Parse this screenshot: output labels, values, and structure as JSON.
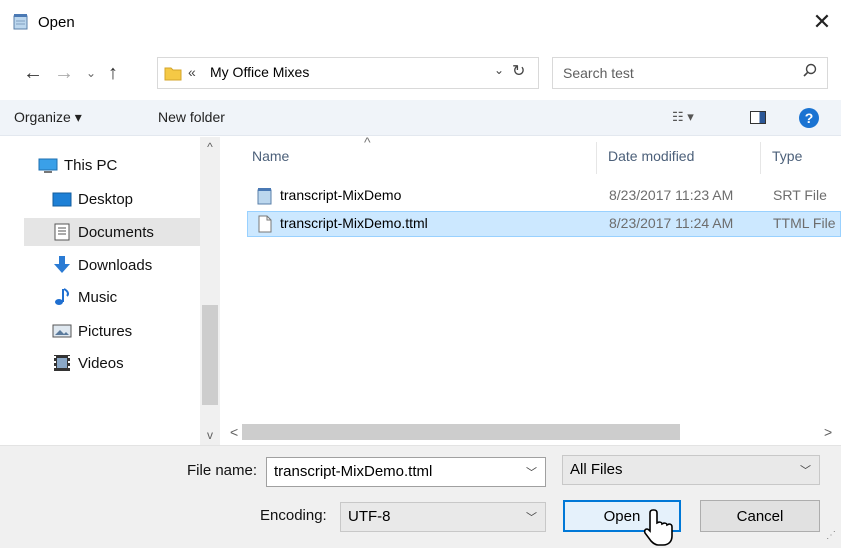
{
  "window": {
    "title": "Open",
    "close_label": "✕"
  },
  "nav": {
    "back": "←",
    "forward": "→",
    "recent": "⌄",
    "up": "↑",
    "breadcrumb_chevron": "«",
    "address": "My Office Mixes",
    "address_dropdown": "⌄",
    "refresh": "↻",
    "search_placeholder": "Search test",
    "search_icon": "⚲"
  },
  "toolbar": {
    "organize": "Organize ▾",
    "new_folder": "New folder",
    "views": "☷ ▾",
    "help": "?"
  },
  "sidebar": {
    "items": [
      {
        "label": "This PC",
        "icon": "pc-icon"
      },
      {
        "label": "Desktop",
        "icon": "desktop-icon"
      },
      {
        "label": "Documents",
        "icon": "documents-icon",
        "selected": true
      },
      {
        "label": "Downloads",
        "icon": "downloads-icon"
      },
      {
        "label": "Music",
        "icon": "music-icon"
      },
      {
        "label": "Pictures",
        "icon": "pictures-icon"
      },
      {
        "label": "Videos",
        "icon": "videos-icon"
      }
    ],
    "scroll_up": "^",
    "scroll_down": "v"
  },
  "filelist": {
    "columns": {
      "name": "Name",
      "date": "Date modified",
      "type": "Type",
      "sort_arrow": "^"
    },
    "rows": [
      {
        "name": "transcript-MixDemo",
        "date": "8/23/2017 11:23 AM",
        "type": "SRT File",
        "selected": false
      },
      {
        "name": "transcript-MixDemo.ttml",
        "date": "8/23/2017 11:24 AM",
        "type": "TTML File",
        "selected": true
      }
    ],
    "scroll_left": "<",
    "scroll_right": ">"
  },
  "bottom": {
    "file_name_label": "File name:",
    "file_name_value": "transcript-MixDemo.ttml",
    "filter_value": "All Files",
    "encoding_label": "Encoding:",
    "encoding_value": "UTF-8",
    "open_label": "Open",
    "cancel_label": "Cancel",
    "dropdown_arrow": "﹀"
  },
  "colors": {
    "accent": "#0078d7",
    "selection": "#cce8ff",
    "help": "#1a73d2"
  }
}
